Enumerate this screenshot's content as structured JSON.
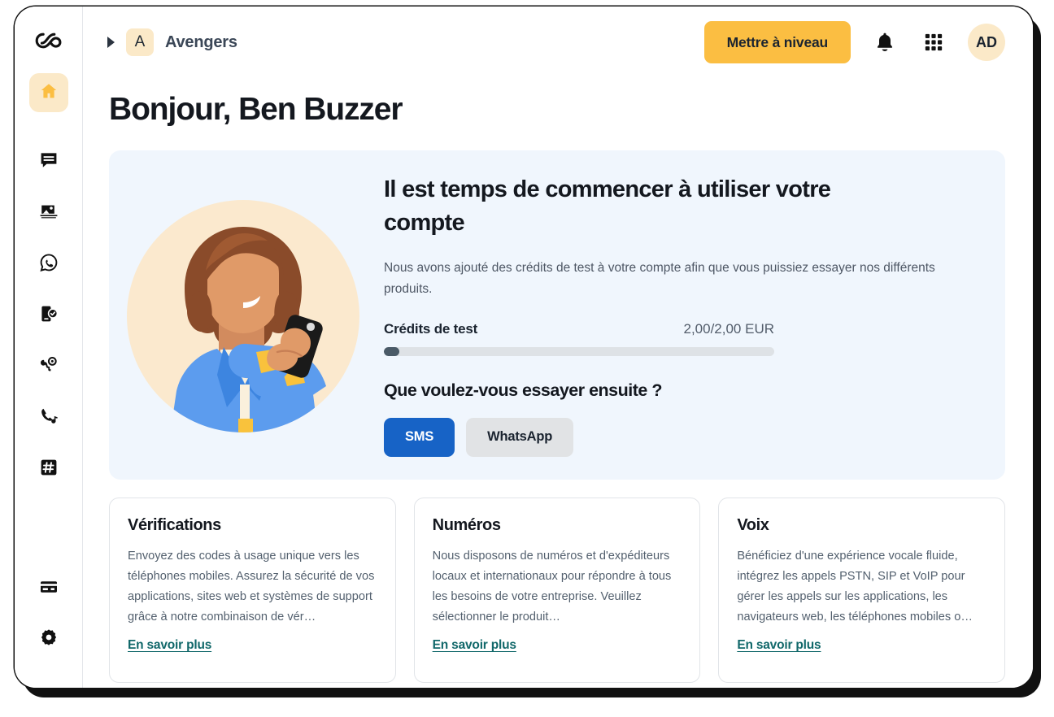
{
  "sidebar": {
    "logo_icon": "infinity-logo-icon",
    "items": [
      {
        "icon": "home-icon",
        "name": "home",
        "active": true
      },
      {
        "icon": "chat-bubble-icon",
        "name": "messaging",
        "active": false
      },
      {
        "icon": "inbox-image-icon",
        "name": "inbox",
        "active": false
      },
      {
        "icon": "whatsapp-icon",
        "name": "whatsapp",
        "active": false
      },
      {
        "icon": "phone-verify-icon",
        "name": "verification",
        "active": false
      },
      {
        "icon": "lookup-icon",
        "name": "lookup",
        "active": false
      },
      {
        "icon": "phone-call-icon",
        "name": "voice",
        "active": false
      },
      {
        "icon": "hash-icon",
        "name": "numbers",
        "active": false
      }
    ],
    "bottom_items": [
      {
        "icon": "credit-card-icon",
        "name": "billing"
      },
      {
        "icon": "gear-icon",
        "name": "settings"
      }
    ]
  },
  "topbar": {
    "caret_icon": "caret-right-icon",
    "workspace_initial": "A",
    "workspace_name": "Avengers",
    "upgrade_label": "Mettre à niveau",
    "bell_icon": "bell-icon",
    "apps_icon": "grid-apps-icon",
    "avatar_initials": "AD"
  },
  "page": {
    "title": "Bonjour, Ben Buzzer"
  },
  "hero": {
    "illustration_name": "woman-with-phone-illustration",
    "title": "Il est temps de commencer à utiliser votre compte",
    "subtitle": "Nous avons ajouté des crédits de test à votre compte afin que vous puissiez essayer nos différents produits.",
    "credits_label": "Crédits de test",
    "credits_value": "2,00/2,00 EUR",
    "progress_percent": 4,
    "question": "Que voulez-vous essayer ensuite ?",
    "actions": [
      {
        "label": "SMS",
        "variant": "primary"
      },
      {
        "label": "WhatsApp",
        "variant": "secondary"
      }
    ]
  },
  "cards": [
    {
      "title": "Vérifications",
      "description": "Envoyez des codes à usage unique vers les téléphones mobiles. Assurez la sécurité de vos applications, sites web et systèmes de support grâce à notre combinaison de vér…",
      "link": "En savoir plus"
    },
    {
      "title": "Numéros",
      "description": "Nous disposons de numéros et d'expéditeurs locaux et internationaux pour répondre à tous les besoins de votre entreprise. Veuillez sélectionner le produit…",
      "link": "En savoir plus"
    },
    {
      "title": "Voix",
      "description": "Bénéficiez d'une expérience vocale fluide, intégrez les appels PSTN, SIP et VoIP pour gérer les appels sur les applications, les navigateurs web, les téléphones mobiles o…",
      "link": "En savoir plus"
    }
  ],
  "colors": {
    "accent_yellow": "#FBBE42",
    "accent_cream": "#FBE9C8",
    "hero_bg": "#F0F6FD",
    "primary_blue": "#1763C6",
    "link_teal": "#11686A",
    "progress_fill": "#4A5A67",
    "progress_track": "#DEE2E6"
  }
}
